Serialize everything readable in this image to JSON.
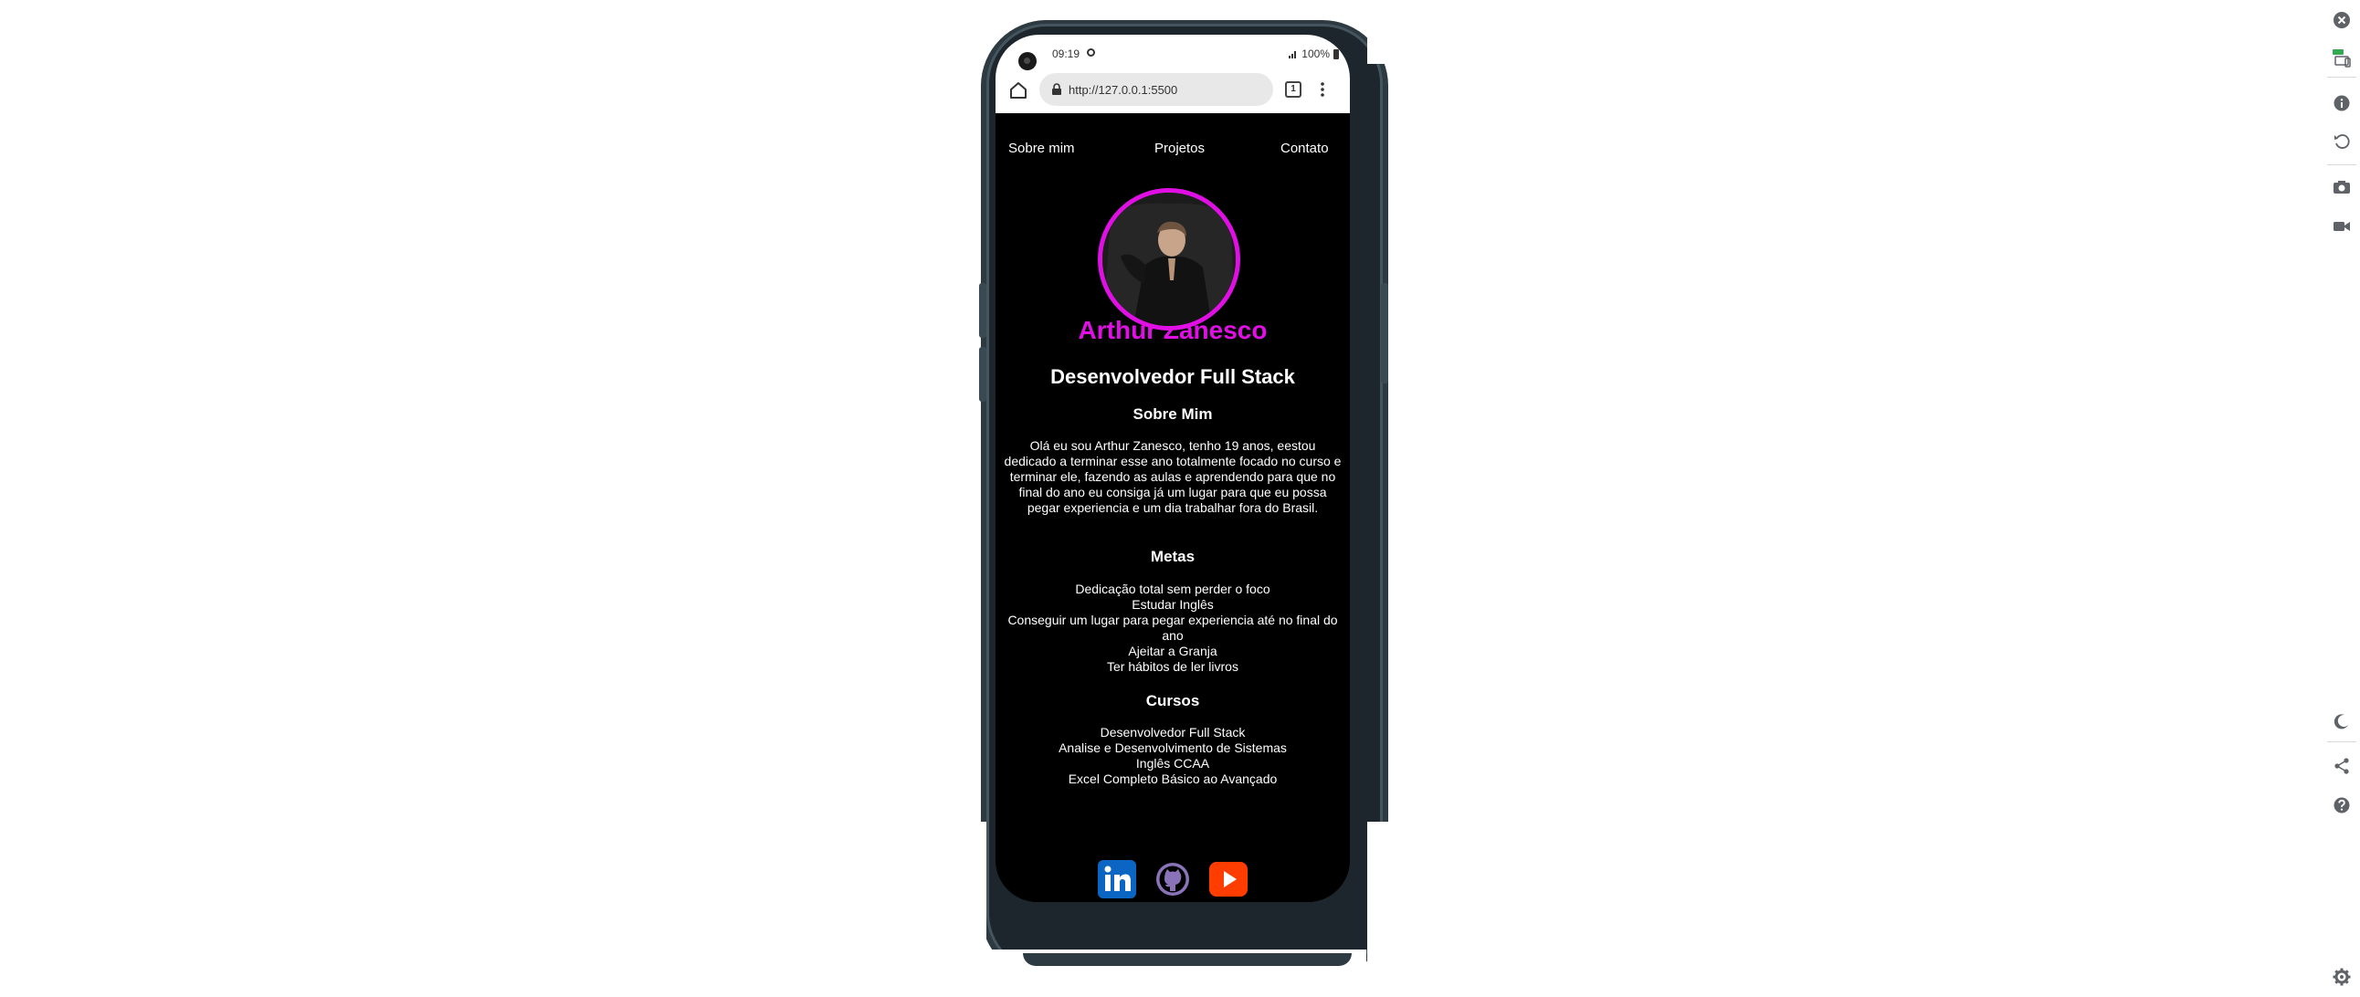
{
  "status_bar": {
    "time": "09:19",
    "battery": "100%"
  },
  "browser": {
    "url": "http://127.0.0.1:5500",
    "tab_count": "1"
  },
  "nav": {
    "items": [
      {
        "label": "Sobre mim"
      },
      {
        "label": "Projetos"
      },
      {
        "label": "Contato"
      }
    ]
  },
  "profile": {
    "name": "Arthur Zanesco",
    "role": "Desenvolvedor Full Stack"
  },
  "about": {
    "heading": "Sobre Mim",
    "text": "Olá eu sou Arthur Zanesco, tenho 19 anos, eestou dedicado a terminar esse ano totalmente focado no curso e terminar ele, fazendo as aulas e aprendendo para que no final do ano eu consiga já um lugar para que eu possa pegar experiencia e um dia trabalhar fora do Brasil."
  },
  "goals": {
    "heading": "Metas",
    "items": [
      "Dedicação total sem perder o foco",
      "Estudar Inglês",
      "Conseguir um lugar para pegar experiencia até no final do ano",
      "Ajeitar a Granja",
      "Ter hábitos de ler livros"
    ]
  },
  "courses": {
    "heading": "Cursos",
    "items": [
      "Desenvolvedor Full Stack",
      "Analise e Desenvolvimento de Sistemas",
      "Inglês CCAA",
      "Excel Completo Básico ao Avançado"
    ]
  },
  "socials": [
    {
      "icon": "linkedin-icon",
      "color": "#0a66c2"
    },
    {
      "icon": "github-icon",
      "color": "#8a73b8"
    },
    {
      "icon": "youtube-icon",
      "color": "#ff3d00"
    }
  ],
  "colors": {
    "accent": "#e010e4",
    "page_background": "#000000",
    "text": "#ffffff"
  },
  "toolbar": {
    "icons": [
      "close-icon",
      "device-icon",
      "info-icon",
      "rotate-icon",
      "screenshot-icon",
      "record-icon",
      "dark-mode-icon",
      "share-icon",
      "help-icon",
      "settings-icon"
    ]
  }
}
